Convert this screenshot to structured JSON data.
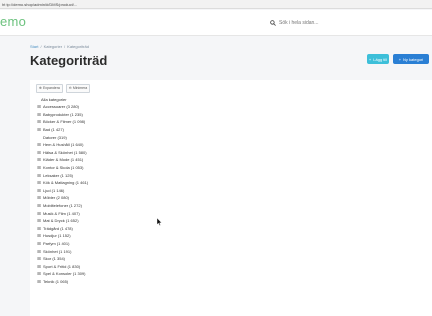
{
  "browser": {
    "url": "ht tp://demo.shop/admin/#/DMS/product/..."
  },
  "header": {
    "logo": "emo",
    "search_placeholder": "Sök i hela sidan..."
  },
  "breadcrumb": {
    "home": "Start",
    "sep": "/",
    "path": [
      "Kategorier",
      "Kategoriträd"
    ]
  },
  "page": {
    "title": "Kategoriträd"
  },
  "buttons": {
    "add": "Lägg till",
    "new": "Ny kategori"
  },
  "toolbar": {
    "expand": "Expandera",
    "collapse": "Minimera"
  },
  "tree": {
    "root": "Alla kategorier",
    "items": [
      {
        "label": "Accessoarer (3 280)",
        "expandable": true
      },
      {
        "label": "Babyprodukter (1 235)",
        "expandable": true
      },
      {
        "label": "Böcker & Filmer (1 098)",
        "expandable": true
      },
      {
        "label": "Bad (1 427)",
        "expandable": true
      },
      {
        "label": "Datorer (319)",
        "expandable": false
      },
      {
        "label": "Hem & Hushåll (1 640)",
        "expandable": true
      },
      {
        "label": "Hälsa & Skönhet (1 580)",
        "expandable": true
      },
      {
        "label": "Kläder & Mode (1 451)",
        "expandable": true
      },
      {
        "label": "Kontor & Skola (1 053)",
        "expandable": true
      },
      {
        "label": "Leksaker (1 125)",
        "expandable": true
      },
      {
        "label": "Kök & Matlagning (1 461)",
        "expandable": true
      },
      {
        "label": "Ljud (1 146)",
        "expandable": true
      },
      {
        "label": "Möbler (2 080)",
        "expandable": true
      },
      {
        "label": "Mobiltelefoner (1 272)",
        "expandable": true
      },
      {
        "label": "Musik & Film (1 407)",
        "expandable": true
      },
      {
        "label": "Mat & Dryck (1 652)",
        "expandable": true
      },
      {
        "label": "Trädgård (1 478)",
        "expandable": true
      },
      {
        "label": "Husdjur (1 152)",
        "expandable": true
      },
      {
        "label": "Parfym (1 401)",
        "expandable": true
      },
      {
        "label": "Skönhet (1 191)",
        "expandable": true
      },
      {
        "label": "Skor (1 354)",
        "expandable": true
      },
      {
        "label": "Sport & Fritid (1 830)",
        "expandable": true
      },
      {
        "label": "Spel & Konsoler (1 309)",
        "expandable": true
      },
      {
        "label": "Teknik (1 065)",
        "expandable": true
      }
    ]
  }
}
